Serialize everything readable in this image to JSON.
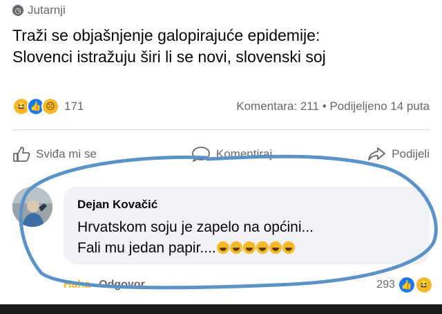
{
  "post": {
    "source_name": "Jutarnji",
    "source_icon": "clock-icon",
    "title_line1": "Traži se objašnjenje galopirajuće epidemije:",
    "title_line2": "Slovenci istražuju širi li se novi, slovenski soj"
  },
  "stats": {
    "reaction_icons": [
      "haha-emoji",
      "like-emoji",
      "sad-emoji"
    ],
    "reaction_count": "171",
    "comments": "Komentara: 211",
    "separator": "•",
    "shares": "Podijeljeno 14 puta"
  },
  "actions": {
    "like_label": "Sviđa mi se",
    "comment_label": "Komentiraj",
    "share_label": "Podijeli"
  },
  "comment": {
    "author": "Dejan Kovačić",
    "line1": "Hrvatskom soju je zapelo na općini...",
    "line2": "Fali mu jedan papir....",
    "laugh_emoji_count": 6,
    "haha_label": "Haha",
    "reply_label": "Odgovor",
    "reaction_count": "293",
    "reaction_icons": [
      "like-emoji",
      "haha-emoji"
    ]
  },
  "colors": {
    "facebook_blue": "#1877f2",
    "text_primary": "#050505",
    "text_secondary": "#65676b",
    "annotation_outline": "#5b93c7",
    "emoji_yellow": "#f7b928"
  }
}
